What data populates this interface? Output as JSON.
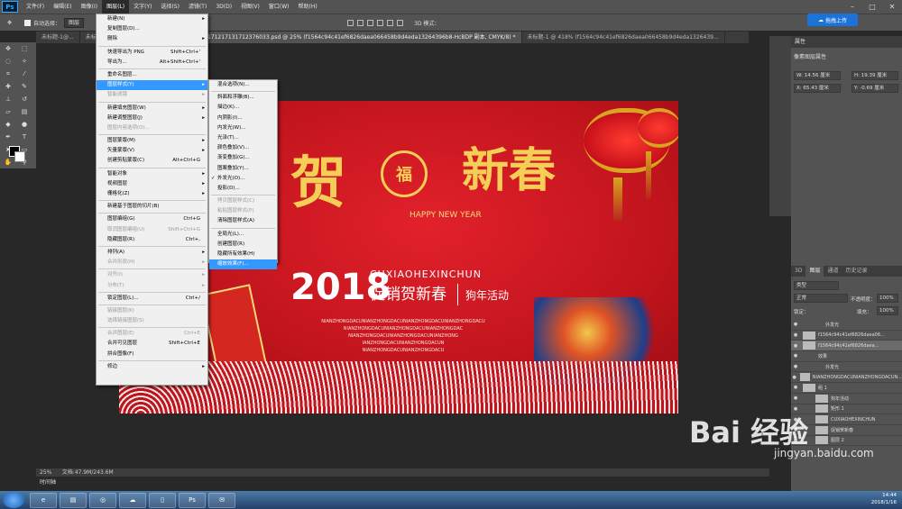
{
  "app": {
    "logo": "Ps"
  },
  "menubar": [
    "文件(F)",
    "编辑(E)",
    "图像(I)",
    "图层(L)",
    "文字(Y)",
    "选择(S)",
    "滤镜(T)",
    "3D(D)",
    "视图(V)",
    "窗口(W)",
    "帮助(H)"
  ],
  "options": {
    "auto_select": "自动选择：",
    "layer_dd": "图层",
    "mode3d": "3D 模式："
  },
  "cloud_button": "拖拽上传",
  "tabs": [
    "未标题-1@...",
    "未标-图标.psd @ 12...",
    "1561025756751_20171217131712376033.psd @ 25% (f1564c94c41ef6826daea066458b9d4eda13264396b8-HcBDP 副本, CMYK/8) *",
    "未标题-1 @ 418% (f1564c94c41ef6826daea066458b9d4eda1326439..."
  ],
  "layer_menu": [
    {
      "label": "新建(N)",
      "arrow": true
    },
    {
      "label": "复制图层(D)..."
    },
    {
      "label": "删除",
      "arrow": true
    },
    {
      "sep": true
    },
    {
      "label": "快速导出为 PNG",
      "sc": "Shift+Ctrl+'"
    },
    {
      "label": "导出为...",
      "sc": "Alt+Shift+Ctrl+'"
    },
    {
      "sep": true
    },
    {
      "label": "重命名图层..."
    },
    {
      "label": "图层样式(Y)",
      "arrow": true,
      "hl": true
    },
    {
      "label": "智能滤镜",
      "dis": true,
      "arrow": true
    },
    {
      "sep": true
    },
    {
      "label": "新建填充图层(W)",
      "arrow": true
    },
    {
      "label": "新建调整图层(J)",
      "arrow": true
    },
    {
      "label": "图层内容选项(O)...",
      "dis": true
    },
    {
      "sep": true
    },
    {
      "label": "图层蒙版(M)",
      "arrow": true
    },
    {
      "label": "矢量蒙版(V)",
      "arrow": true
    },
    {
      "label": "创建剪贴蒙版(C)",
      "sc": "Alt+Ctrl+G"
    },
    {
      "sep": true
    },
    {
      "label": "智能对象",
      "arrow": true
    },
    {
      "label": "视频图层",
      "arrow": true
    },
    {
      "label": "栅格化(Z)",
      "arrow": true
    },
    {
      "sep": true
    },
    {
      "label": "新建基于图层的切片(B)"
    },
    {
      "sep": true
    },
    {
      "label": "图层编组(G)",
      "sc": "Ctrl+G"
    },
    {
      "label": "取消图层编组(U)",
      "sc": "Shift+Ctrl+G",
      "dis": true
    },
    {
      "label": "隐藏图层(R)",
      "sc": "Ctrl+,"
    },
    {
      "sep": true
    },
    {
      "label": "排列(A)",
      "arrow": true
    },
    {
      "label": "合并形状(H)",
      "dis": true,
      "arrow": true
    },
    {
      "sep": true
    },
    {
      "label": "对齐(I)",
      "dis": true,
      "arrow": true
    },
    {
      "label": "分布(T)",
      "dis": true,
      "arrow": true
    },
    {
      "sep": true
    },
    {
      "label": "锁定图层(L)...",
      "sc": "Ctrl+/"
    },
    {
      "sep": true
    },
    {
      "label": "链接图层(K)",
      "dis": true
    },
    {
      "label": "选择链接图层(S)",
      "dis": true
    },
    {
      "sep": true
    },
    {
      "label": "合并图层(E)",
      "sc": "Ctrl+E",
      "dis": true
    },
    {
      "label": "合并可见图层",
      "sc": "Shift+Ctrl+E"
    },
    {
      "label": "拼合图像(F)"
    },
    {
      "sep": true
    },
    {
      "label": "修边",
      "arrow": true
    }
  ],
  "style_submenu": [
    {
      "label": "混合选项(N)..."
    },
    {
      "sep": true
    },
    {
      "label": "斜面和浮雕(B)..."
    },
    {
      "label": "描边(K)..."
    },
    {
      "label": "内阴影(I)..."
    },
    {
      "label": "内发光(W)..."
    },
    {
      "label": "光泽(T)..."
    },
    {
      "label": "颜色叠加(V)..."
    },
    {
      "label": "渐变叠加(G)..."
    },
    {
      "label": "图案叠加(Y)..."
    },
    {
      "label": "外发光(O)...",
      "check": "✓"
    },
    {
      "label": "投影(D)..."
    },
    {
      "sep": true
    },
    {
      "label": "拷贝图层样式(C)",
      "dis": true
    },
    {
      "label": "粘贴图层样式(P)",
      "dis": true
    },
    {
      "label": "清除图层样式(A)"
    },
    {
      "sep": true
    },
    {
      "label": "全局光(L)..."
    },
    {
      "label": "创建图层(R)"
    },
    {
      "label": "隐藏所有效果(H)"
    },
    {
      "label": "缩放效果(F)...",
      "hl": true
    }
  ],
  "poster": {
    "he": "贺",
    "xinchun": "新春",
    "fu": "福",
    "happy": "HAPPY NEW YEAR",
    "year": "2018",
    "pinyin": "CUXIAOHEXINCHUN",
    "promo": "促销贺新春",
    "dog": "狗年活动",
    "lines": [
      "NIANZHONGDACUNIANZHONGDACUNIANZHONGDACUNIANZHONGDACU",
      "NIANZHONGDACUNIANZHONGDACUNIANZHONGDAC",
      "NIANZHONGDACUNIANZHONGDACUNIANZHONG",
      "IANZHONGDACUNIANZHONGDACUN",
      "NIANZHONGDACUNIANZHONGDACU"
    ]
  },
  "properties": {
    "tab": "属性",
    "title": "像素图层属性",
    "w": "14.56 厘米",
    "h": "19.39 厘米",
    "x": "65.43 厘米",
    "y": "-0.69 厘米"
  },
  "layers": {
    "tabs": [
      "3D",
      "图层",
      "通道",
      "历史记录"
    ],
    "kind": "类型",
    "blend": "正常",
    "opacity_label": "不透明度：",
    "opacity": "100%",
    "lock_label": "锁定：",
    "fill_label": "填充：",
    "fill": "100%",
    "rows": [
      {
        "name": "外发光",
        "indent": 28
      },
      {
        "name": "f1564c94c41ef6826daea06..."
      },
      {
        "name": "f1564c94c41ef6826daea...",
        "sel": true
      },
      {
        "name": "效果",
        "indent": 20
      },
      {
        "name": "外发光",
        "indent": 28
      },
      {
        "name": "NIANZHONGDACUNIANZHONGDACUN..."
      },
      {
        "name": "组 1"
      },
      {
        "name": "狗年活动",
        "indent": 14
      },
      {
        "name": "矩形 1",
        "indent": 14
      },
      {
        "name": "CUXIAOHEXINCHUN",
        "indent": 14
      },
      {
        "name": "促销贺新春",
        "indent": 14
      },
      {
        "name": "图层 2",
        "indent": 14
      }
    ]
  },
  "status": {
    "zoom": "25%",
    "doc": "文档:47.9M/243.6M"
  },
  "timeline": "时间轴",
  "clock": {
    "time": "14:44",
    "date": "2018/1/16"
  },
  "watermark": {
    "brand": "Bai 经验",
    "url": "jingyan.baidu.com"
  }
}
